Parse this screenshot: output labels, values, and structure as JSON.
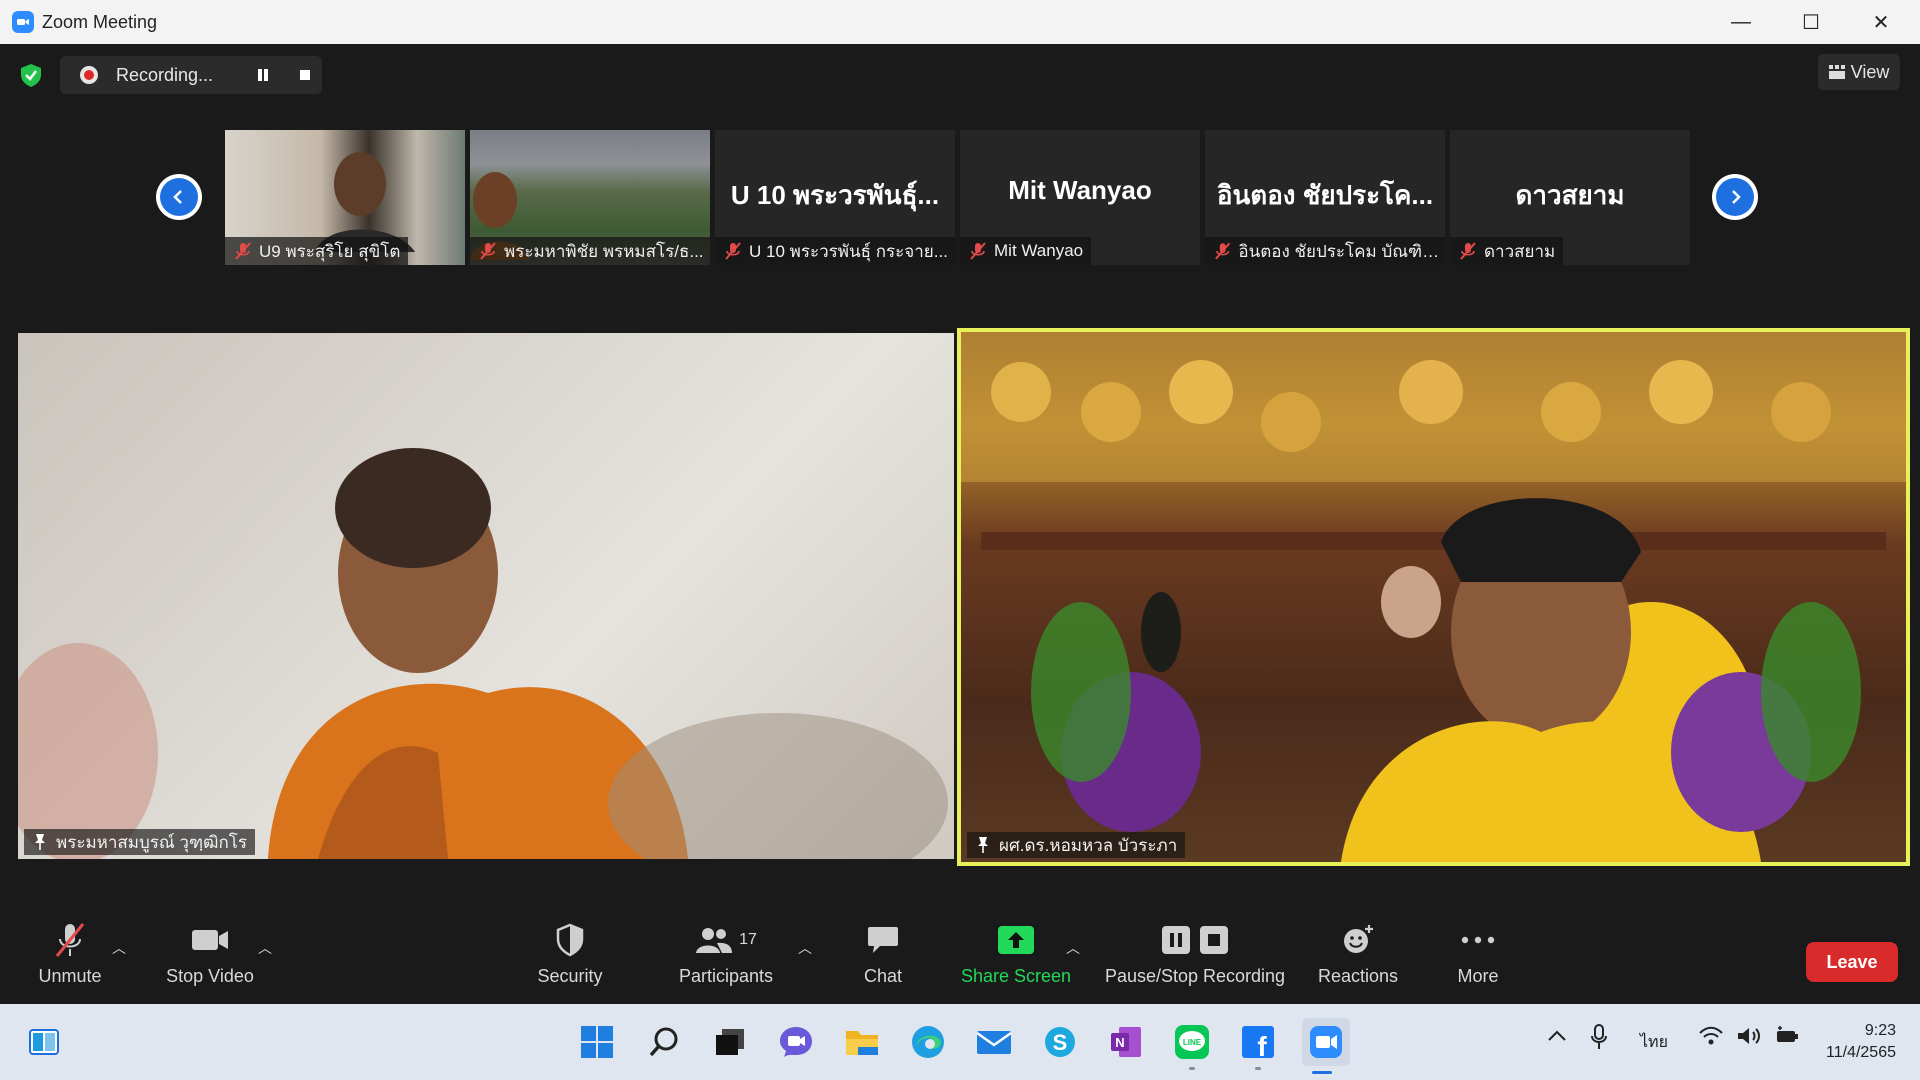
{
  "window": {
    "title": "Zoom Meeting",
    "minimize": "—",
    "maximize": "☐",
    "close": "✕"
  },
  "topbar": {
    "recording_label": "Recording...",
    "view_label": "View"
  },
  "filmstrip": [
    {
      "name": "U9 พระสุริโย สุขิโต",
      "big": ""
    },
    {
      "name": "พระมหาพิชัย พรหมสโร/ธ...",
      "big": ""
    },
    {
      "name": "U 10 พระวรพันธุ์ กระจาย...",
      "big": "U 10 พระวรพันธุ์..."
    },
    {
      "name": "Mit Wanyao",
      "big": "Mit Wanyao"
    },
    {
      "name": "อินตอง ชัยประโคม บัณฑิต...",
      "big": "อินตอง ชัยประโค..."
    },
    {
      "name": "ดาวสยาม",
      "big": "ดาวสยาม"
    }
  ],
  "main_video": {
    "left_name": "พระมหาสมบูรณ์ วุฑฺฒิกโร",
    "right_name": "ผศ.ดร.หอมหวล บัวระภา"
  },
  "toolbar": {
    "unmute": "Unmute",
    "stop_video": "Stop Video",
    "security": "Security",
    "participants": "Participants",
    "participants_count": "17",
    "chat": "Chat",
    "share_screen": "Share Screen",
    "pause_stop_recording": "Pause/Stop Recording",
    "reactions": "Reactions",
    "more": "More",
    "leave": "Leave"
  },
  "taskbar": {
    "lang": "ไทย",
    "time": "9:23",
    "date": "11/4/2565"
  },
  "colors": {
    "zoom_blue": "#2d8cff",
    "active_speaker_border": "#e8f15a",
    "share_green": "#23d959",
    "leave_red": "#d92b2b"
  }
}
